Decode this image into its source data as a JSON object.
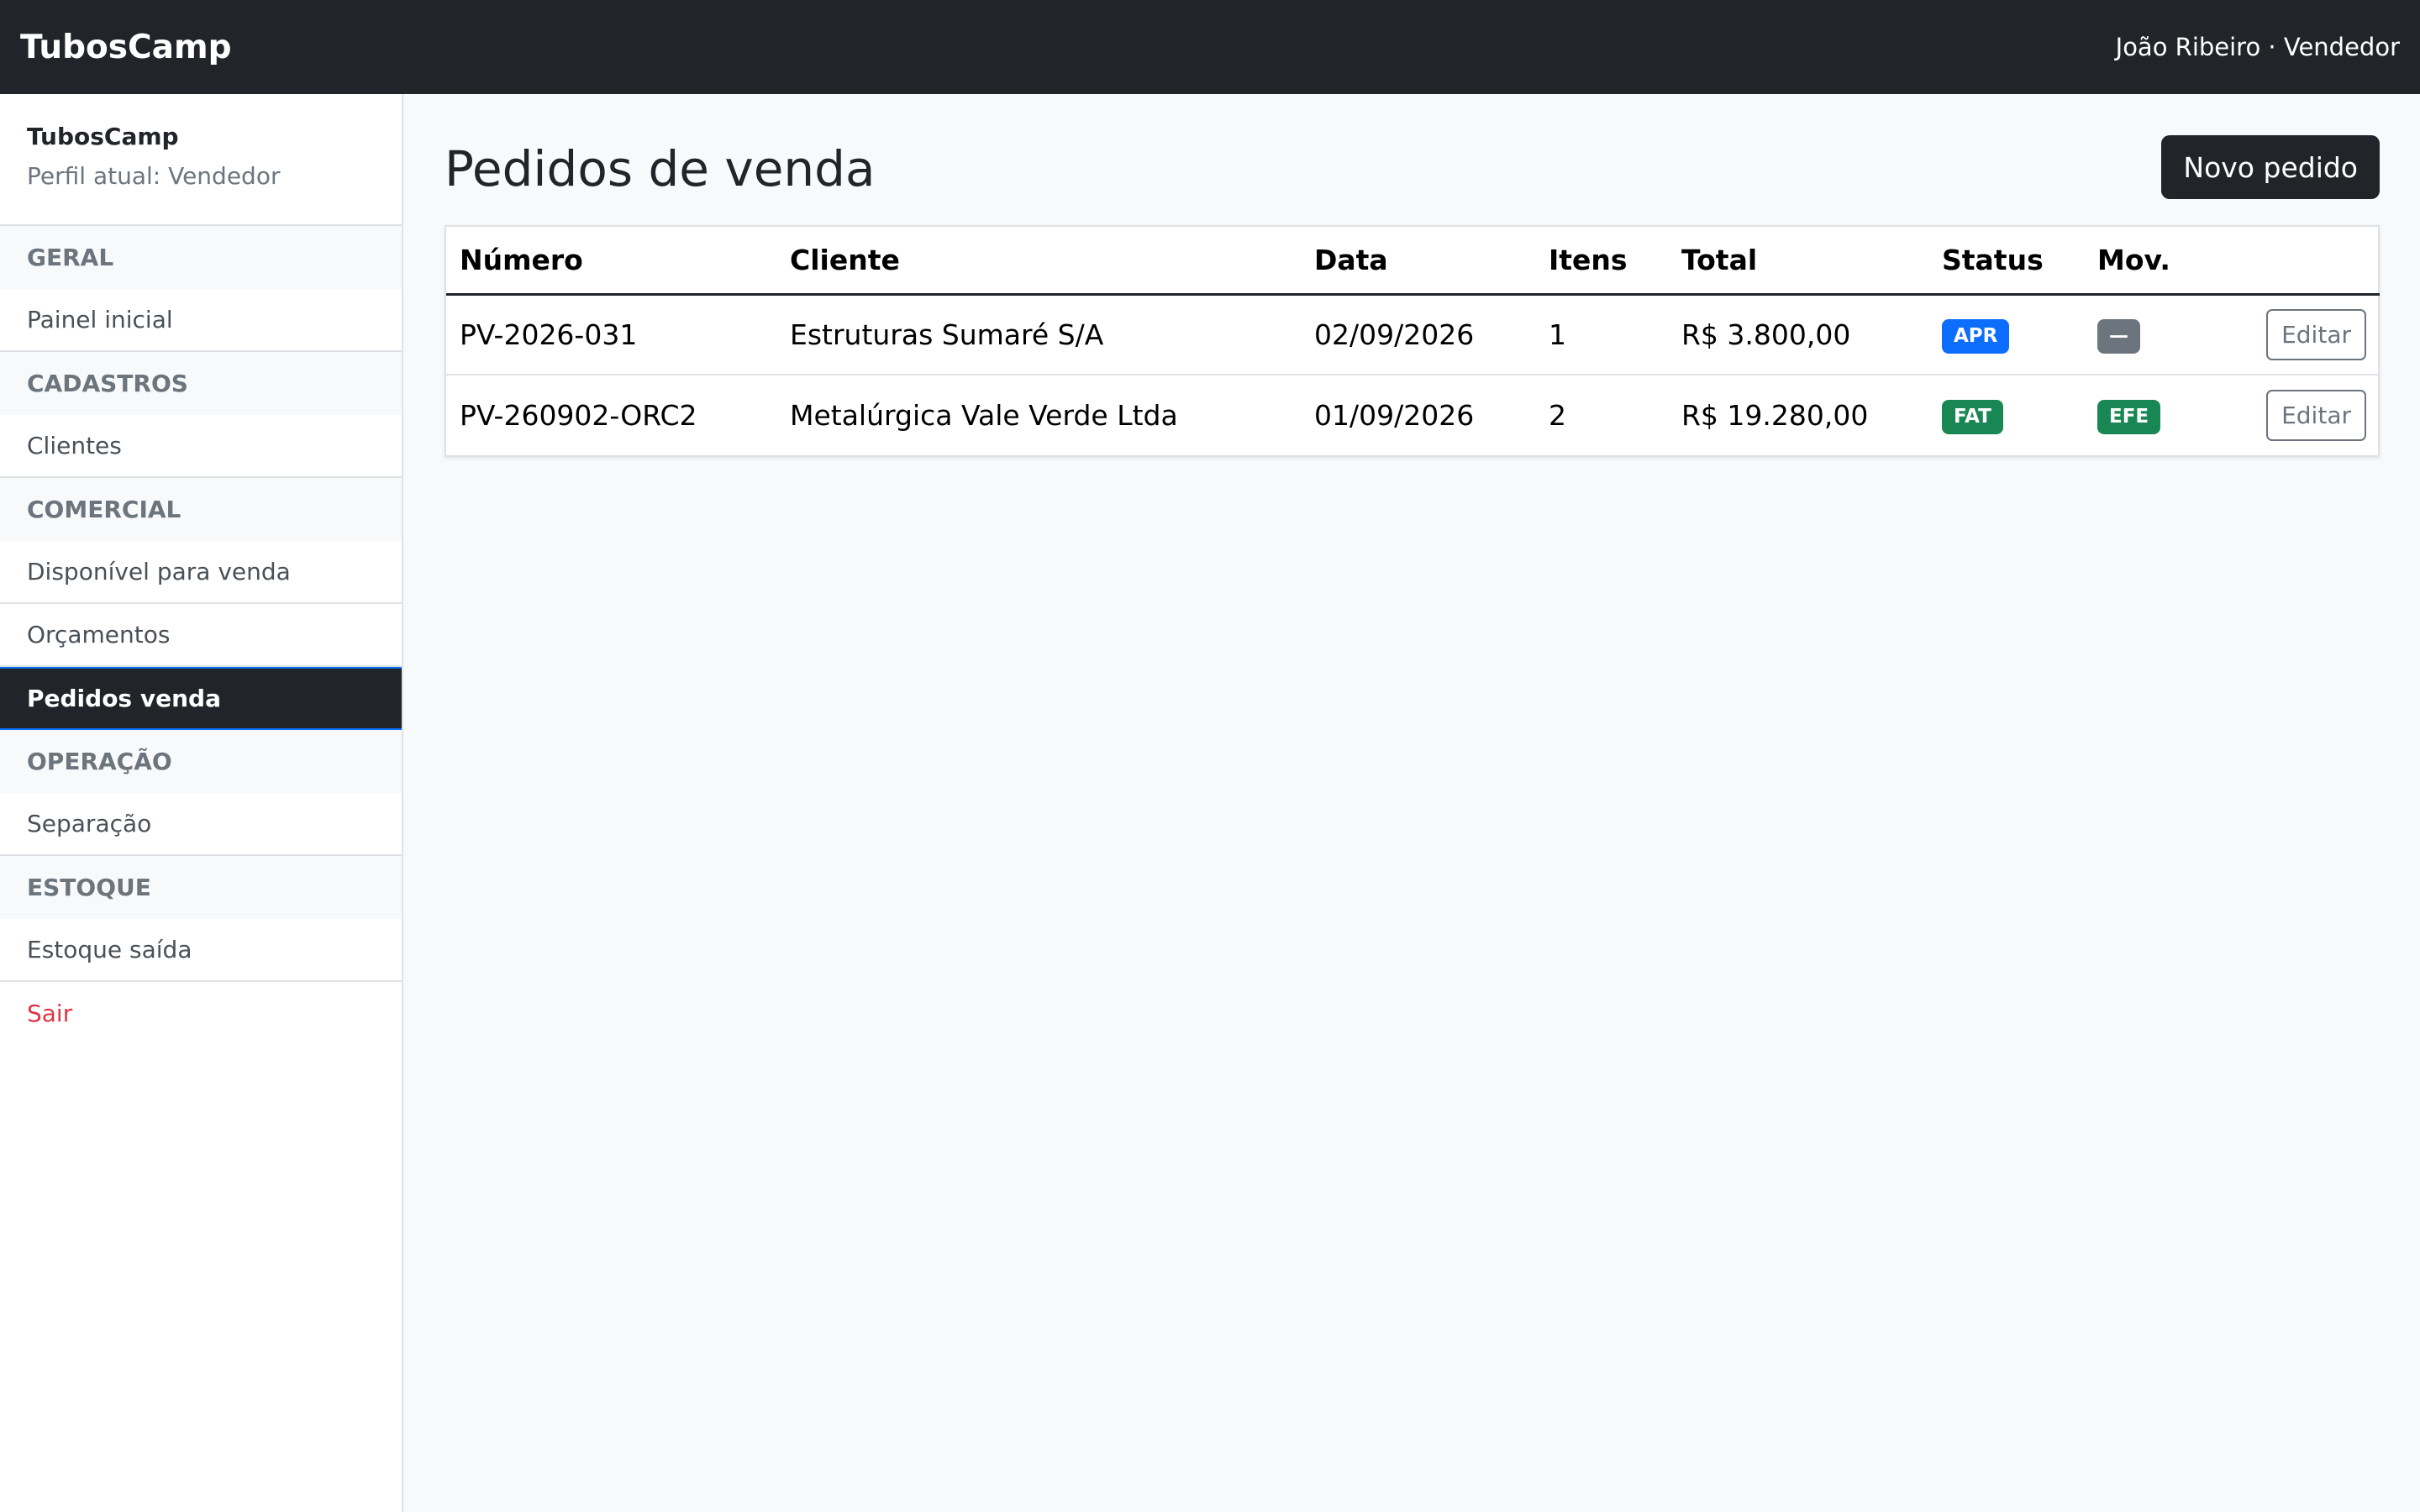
{
  "navbar": {
    "brand": "TubosCamp",
    "user": "João Ribeiro · Vendedor"
  },
  "sidebar": {
    "app_name": "TubosCamp",
    "profile": "Perfil atual: Vendedor",
    "sections": [
      {
        "title": "GERAL",
        "items": [
          {
            "label": "Painel inicial"
          }
        ]
      },
      {
        "title": "CADASTROS",
        "items": [
          {
            "label": "Clientes"
          }
        ]
      },
      {
        "title": "COMERCIAL",
        "items": [
          {
            "label": "Disponível para venda"
          },
          {
            "label": "Orçamentos"
          },
          {
            "label": "Pedidos venda",
            "active": true
          }
        ]
      },
      {
        "title": "OPERAÇÃO",
        "items": [
          {
            "label": "Separação"
          }
        ]
      },
      {
        "title": "ESTOQUE",
        "items": [
          {
            "label": "Estoque saída"
          }
        ]
      }
    ],
    "logout": "Sair"
  },
  "main": {
    "title": "Pedidos de venda",
    "new_button": "Novo pedido",
    "table": {
      "headers": [
        "Número",
        "Cliente",
        "Data",
        "Itens",
        "Total",
        "Status",
        "Mov.",
        ""
      ],
      "rows": [
        {
          "numero": "PV-2026-031",
          "cliente": "Estruturas Sumaré S/A",
          "data": "02/09/2026",
          "itens": "1",
          "total": "R$ 3.800,00",
          "status": "APR",
          "status_color": "#0d6efd",
          "mov": "—",
          "mov_color": "#6c757d",
          "action": "Editar"
        },
        {
          "numero": "PV-260902-ORC2",
          "cliente": "Metalúrgica Vale Verde Ltda",
          "data": "01/09/2026",
          "itens": "2",
          "total": "R$ 19.280,00",
          "status": "FAT",
          "status_color": "#198754",
          "mov": "EFE",
          "mov_color": "#198754",
          "action": "Editar"
        }
      ]
    }
  }
}
